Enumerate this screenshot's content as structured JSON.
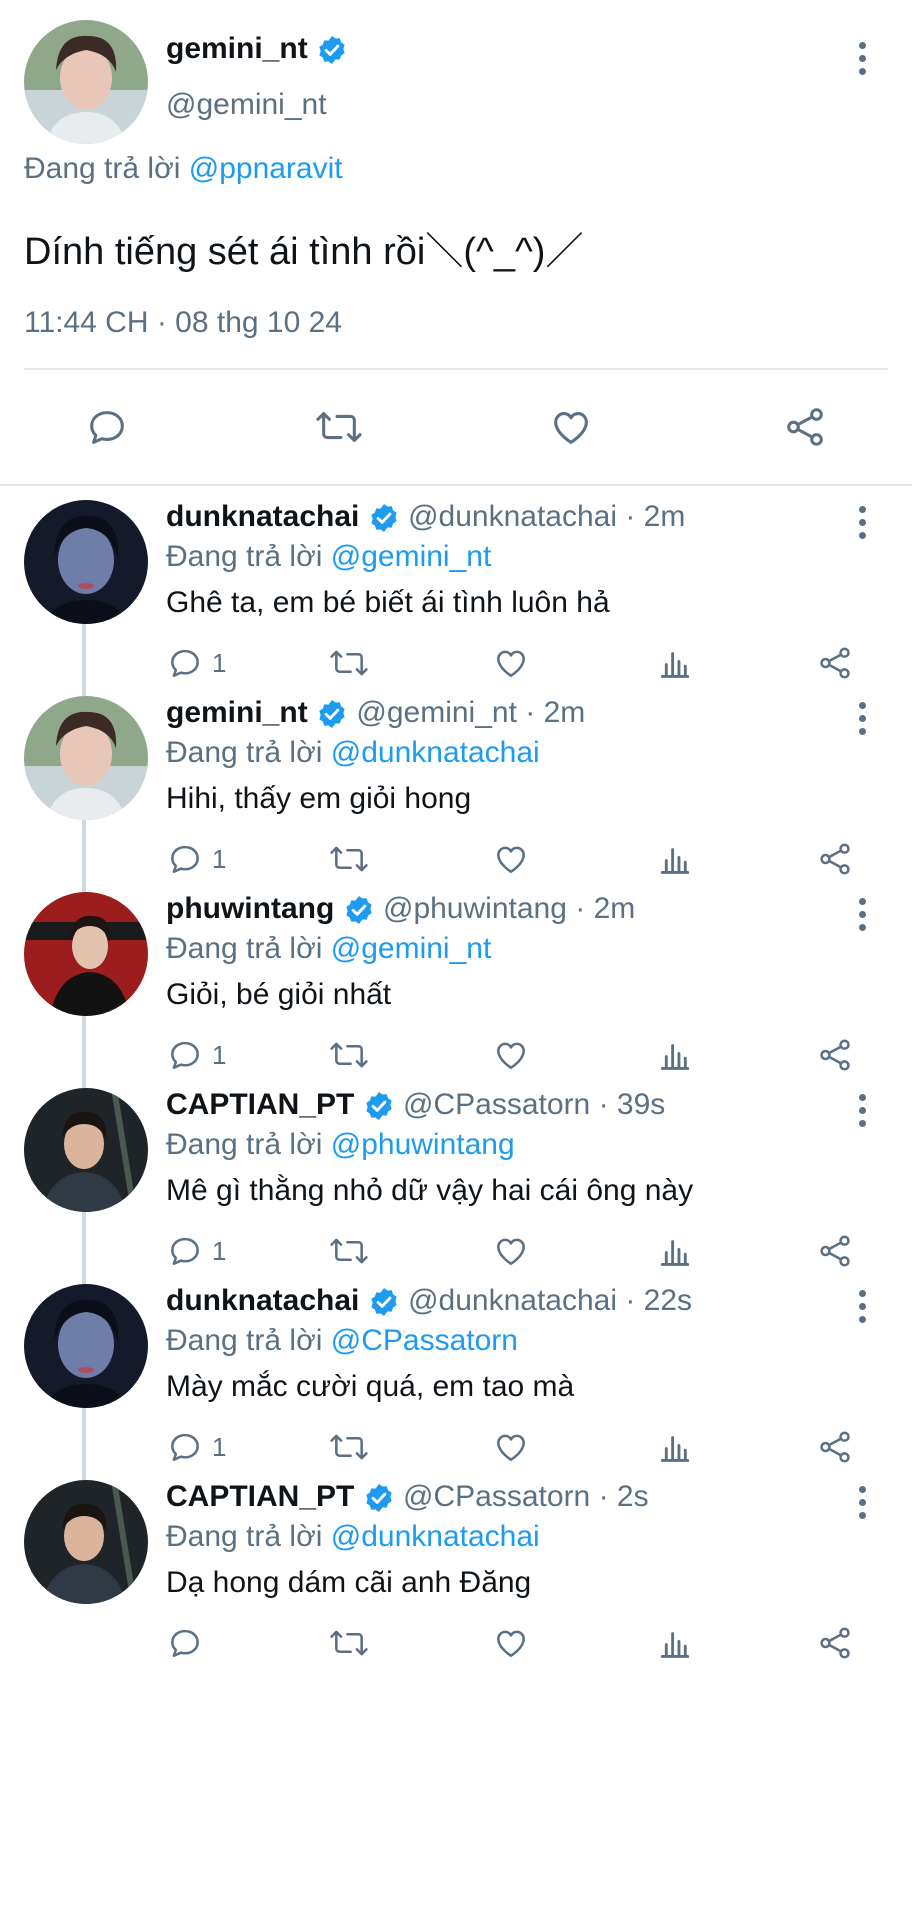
{
  "main_tweet": {
    "display_name": "gemini_nt",
    "handle": "@gemini_nt",
    "replying_prefix": "Đang trả lời",
    "replying_to": "@ppnaravit",
    "text": "Dính tiếng sét ái tình rồi＼(^_^)／",
    "timestamp": "11:44 CH · 08 thg 10 24",
    "actions": [
      "reply-icon",
      "retweet-icon",
      "like-icon",
      "share-icon"
    ]
  },
  "replies": [
    {
      "display_name": "dunknatachai",
      "handle": "@dunknatachai",
      "time": "2m",
      "replying_prefix": "Đang trả lời",
      "replying_to": "@gemini_nt",
      "text": "Ghê ta, em bé biết ái tình luôn hả",
      "reply_count": "1"
    },
    {
      "display_name": "gemini_nt",
      "handle": "@gemini_nt",
      "time": "2m",
      "replying_prefix": "Đang trả lời",
      "replying_to": "@dunknatachai",
      "text": "Hihi, thấy em giỏi hong",
      "reply_count": "1"
    },
    {
      "display_name": "phuwintang",
      "handle": "@phuwintang",
      "time": "2m",
      "replying_prefix": "Đang trả lời",
      "replying_to": "@gemini_nt",
      "text": "Giỏi, bé giỏi nhất",
      "reply_count": "1"
    },
    {
      "display_name": "CAPTIAN_PT",
      "handle": "@CPassatorn",
      "time": "39s",
      "replying_prefix": "Đang trả lời",
      "replying_to": "@phuwintang",
      "text": "Mê gì thằng nhỏ dữ vậy hai cái ông này",
      "reply_count": "1"
    },
    {
      "display_name": "dunknatachai",
      "handle": "@dunknatachai",
      "time": "22s",
      "replying_prefix": "Đang trả lời",
      "replying_to": "@CPassatorn",
      "text": "Mày mắc cười quá, em tao mà",
      "reply_count": "1"
    },
    {
      "display_name": "CAPTIAN_PT",
      "handle": "@CPassatorn",
      "time": "2s",
      "replying_prefix": "Đang trả lời",
      "replying_to": "@dunknatachai",
      "text": "Dạ hong dám cãi anh Đăng",
      "reply_count": ""
    }
  ],
  "separator": " · ",
  "colors": {
    "link": "#1d9bf0",
    "muted": "#5b7083",
    "verified": "#1d9bf0",
    "text": "#0f1419"
  }
}
